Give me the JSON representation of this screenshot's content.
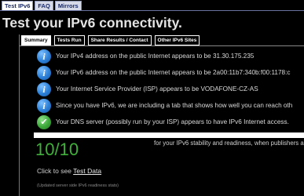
{
  "top_nav": {
    "tabs": [
      {
        "label": "Test IPv6",
        "active": true
      },
      {
        "label": "FAQ",
        "active": false
      },
      {
        "label": "Mirrors",
        "active": false
      }
    ]
  },
  "page_title": "Test your IPv6 connectivity.",
  "content_tabs": [
    {
      "label": "Summary",
      "active": true
    },
    {
      "label": "Tests Run",
      "active": false
    },
    {
      "label": "Share Results / Contact",
      "active": false
    },
    {
      "label": "Other IPv6 Sites",
      "active": false
    }
  ],
  "results": [
    {
      "icon": "info-icon",
      "text": "Your IPv4 address on the public Internet appears to be 31.30.175.235"
    },
    {
      "icon": "info-icon",
      "text": "Your IPv6 address on the public Internet appears to be 2a00:11b7:340b:f00:1178:c"
    },
    {
      "icon": "info-icon",
      "text": "Your Internet Service Provider (ISP) appears to be VODAFONE-CZ-AS"
    },
    {
      "icon": "info-icon",
      "text": "Since you have IPv6, we are including a tab that shows how well you can reach oth"
    },
    {
      "icon": "check-icon",
      "text": "Your DNS server (possibly run by your ISP) appears to have IPv6 Internet access."
    }
  ],
  "score": {
    "value": "10/10",
    "caption": "for your IPv6 stability and readiness, when publishers a"
  },
  "test_data": {
    "prefix": "Click to see",
    "link_label": "Test Data"
  },
  "updated_note": "(Updated server side IPv6 readiness stats)",
  "colors": {
    "background": "#000000",
    "score_green": "#3fb03a",
    "info_blue": "#2b7fd6",
    "check_green": "#3ca83a"
  }
}
